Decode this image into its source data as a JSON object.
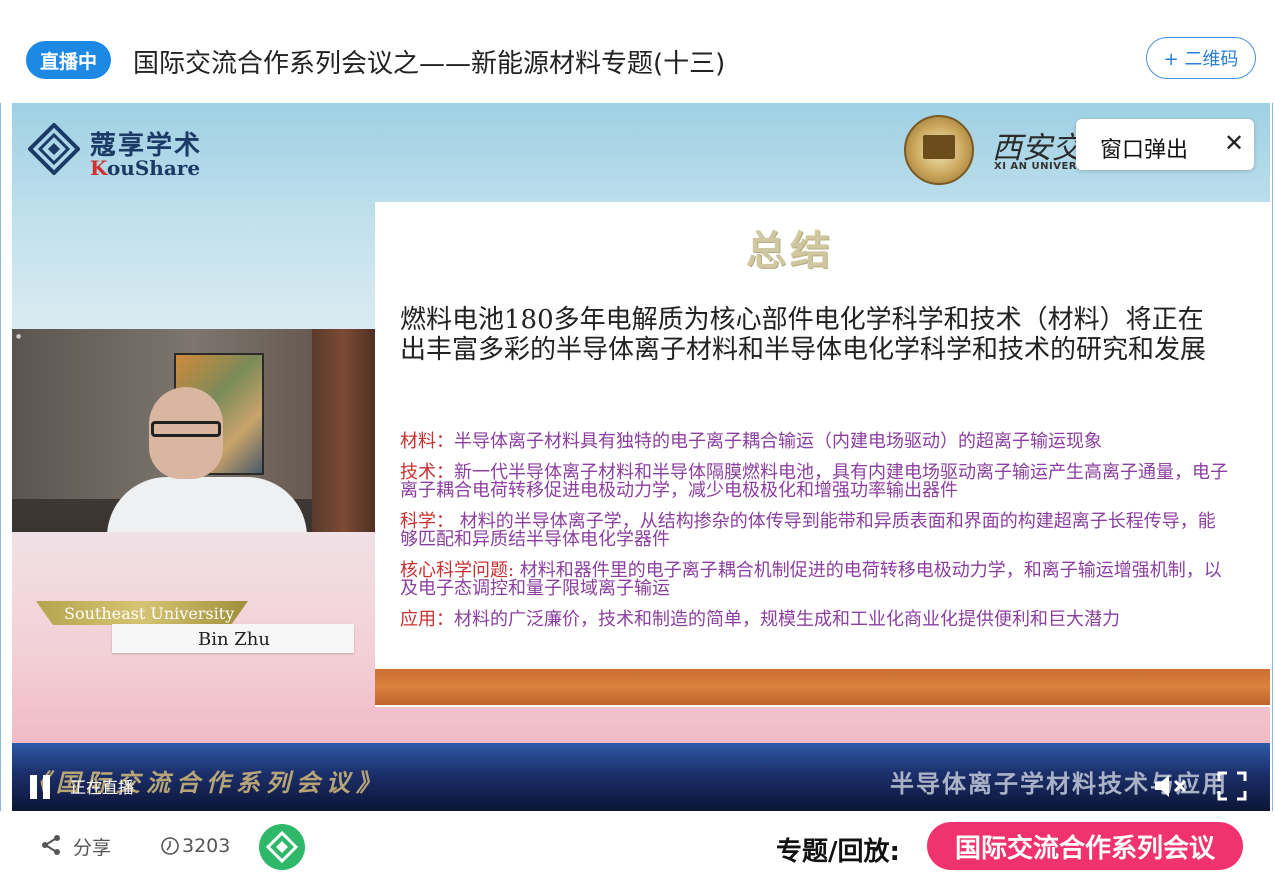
{
  "header": {
    "live_badge": "直播中",
    "title": "国际交流合作系列会议之——新能源材料专题(十三)",
    "qr_button": "+ 二维码"
  },
  "video": {
    "logo": {
      "cn": "蔻享学术",
      "en_k": "K",
      "en_rest": "ouShare"
    },
    "university": {
      "name": "西安交通大学",
      "en": "XI AN UNIVERSITY"
    },
    "popout": {
      "label": "窗口弹出",
      "close": "✕"
    },
    "slide": {
      "title": "总结",
      "main": "燃料电池180多年电解质为核心部件电化学科学和技术（材料）将正在出丰富多彩的半导体离子材料和半导体电化学科学和技术的研究和发展",
      "bullets": [
        {
          "label": "材料：",
          "text": "半导体离子材料具有独特的电子离子耦合输运（内建电场驱动）的超离子输运现象"
        },
        {
          "label": "技术：",
          "text": "新一代半导体离子材料和半导体隔膜燃料电池，具有内建电场驱动离子输运产生高离子通量，电子离子耦合电荷转移促进电极动力学，减少电极极化和增强功率输出器件"
        },
        {
          "label": "科学：",
          "text": " 材料的半导体离子学，从结构掺杂的体传导到能带和异质表面和界面的构建超离子长程传导，能够匹配和异质结半导体电化学器件"
        },
        {
          "label": "核心科学问题:",
          "text": " 材料和器件里的电子离子耦合机制促进的电荷转移电极动力学，和离子输运增强机制，以及电子态调控和量子限域离子输运"
        },
        {
          "label": "应用：",
          "text": "材料的广泛廉价，技术和制造的简单，规模生成和工业化商业化提供便利和巨大潜力"
        }
      ]
    },
    "speaker": {
      "org": "Southeast University",
      "name": "Bin Zhu"
    },
    "banner": {
      "left": "《国际交流合作系列会议》",
      "right": "半导体离子学材料技术与应用"
    },
    "controls": {
      "status": "正在直播"
    }
  },
  "footer": {
    "share_label": "分享",
    "view_count": "3203",
    "topic_label": "专题/回放:",
    "topic_button": "国际交流合作系列会议"
  },
  "colors": {
    "accent_blue": "#1e88e5",
    "topic_pink": "#f0336e",
    "green": "#2fb86a"
  }
}
